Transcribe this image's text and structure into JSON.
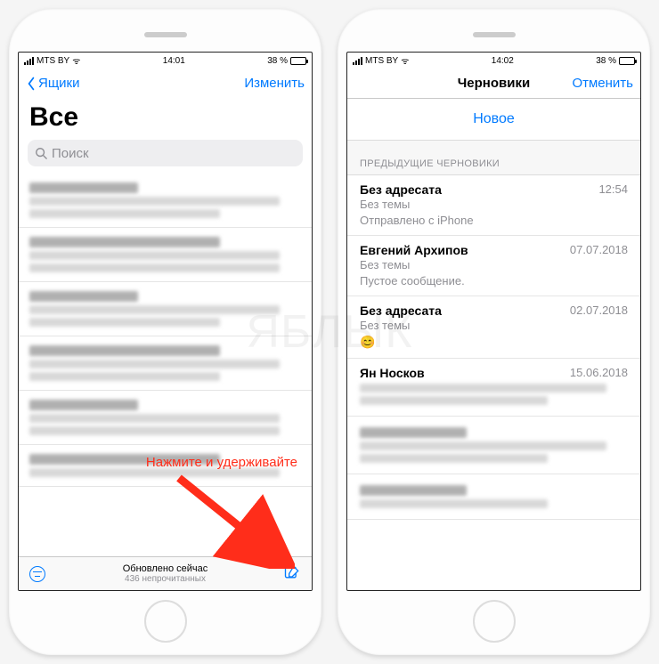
{
  "watermark": "ЯБЛЫК",
  "left": {
    "status": {
      "carrier": "MTS BY",
      "time": "14:01",
      "battery_pct": "38 %"
    },
    "nav": {
      "back": "Ящики",
      "edit": "Изменить"
    },
    "title": "Все",
    "search_placeholder": "Поиск",
    "toolbar": {
      "updated": "Обновлено сейчас",
      "unread": "436 непрочитанных"
    },
    "annotation": "Нажмите и удерживайте"
  },
  "right": {
    "status": {
      "carrier": "MTS BY",
      "time": "14:02",
      "battery_pct": "38 %"
    },
    "nav": {
      "title": "Черновики",
      "cancel": "Отменить"
    },
    "new_button": "Новое",
    "section_header": "ПРЕДЫДУЩИЕ ЧЕРНОВИКИ",
    "drafts": [
      {
        "title": "Без адресата",
        "subject": "Без темы",
        "preview": "Отправлено с iPhone",
        "date": "12:54"
      },
      {
        "title": "Евгений Архипов",
        "subject": "Без темы",
        "preview": "Пустое сообщение.",
        "date": "07.07.2018"
      },
      {
        "title": "Без адресата",
        "subject": "Без темы",
        "preview": "😊",
        "date": "02.07.2018"
      },
      {
        "title": "Ян Носков",
        "subject": "",
        "preview": "",
        "date": "15.06.2018"
      }
    ]
  }
}
